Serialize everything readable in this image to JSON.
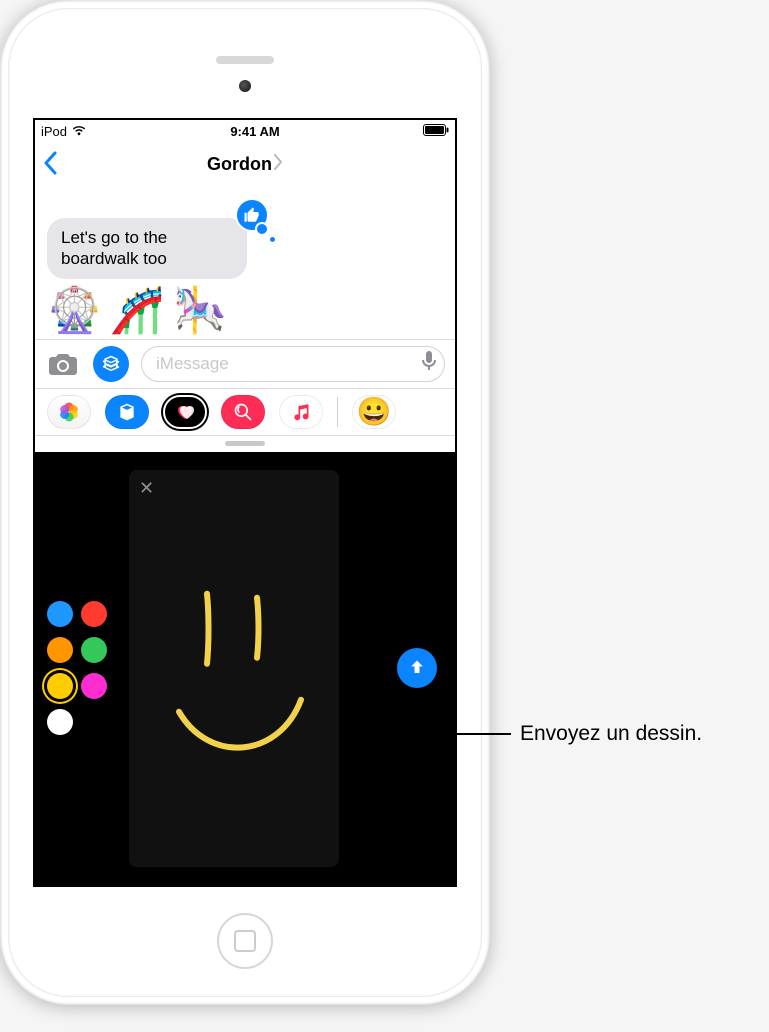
{
  "status": {
    "carrier": "iPod",
    "time": "9:41 AM"
  },
  "nav": {
    "title": "Gordon"
  },
  "conversation": {
    "incoming_text": "Let's go to the boardwalk too",
    "emojis": [
      "🎡",
      "🎢",
      "🎠"
    ]
  },
  "input": {
    "placeholder": "iMessage"
  },
  "app_strip": {
    "photos": "photos-app",
    "store": "app-store",
    "digital_touch": "digital-touch",
    "images": "images-app",
    "music": "music-app",
    "emoji": "😀"
  },
  "palette": [
    {
      "name": "blue",
      "color": "#1e97ff"
    },
    {
      "name": "red",
      "color": "#ff3b30"
    },
    {
      "name": "orange",
      "color": "#ff9500"
    },
    {
      "name": "green",
      "color": "#34c759"
    },
    {
      "name": "yellow",
      "color": "#ffcc00",
      "selected": true
    },
    {
      "name": "magenta",
      "color": "#ff2dd0"
    },
    {
      "name": "white",
      "color": "#ffffff"
    }
  ],
  "callout": {
    "send": "Envoyez un dessin."
  }
}
